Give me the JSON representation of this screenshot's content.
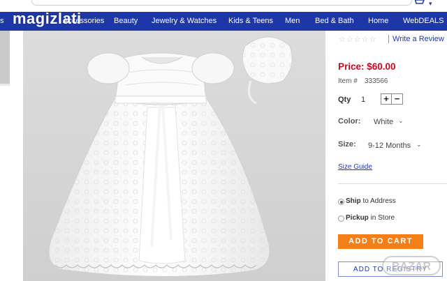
{
  "watermark": {
    "site_name": "magizlati",
    "badge_text": "BAZAR"
  },
  "nav": {
    "items": [
      {
        "label": "s"
      },
      {
        "label": "Accessories"
      },
      {
        "label": "Beauty"
      },
      {
        "label": "Jewelry & Watches"
      },
      {
        "label": "Kids & Teens"
      },
      {
        "label": "Men"
      },
      {
        "label": "Bed & Bath"
      },
      {
        "label": "Home"
      },
      {
        "label": "WebDEALS"
      }
    ],
    "color": "#1e37a8"
  },
  "product": {
    "rating_stars": "☆☆☆☆☆",
    "review_link": "Write a Review",
    "price_label": "Price:",
    "price": "$60.00",
    "price_display": "Price: $60.00",
    "item_label": "Item #",
    "item_number": "333566",
    "qty_label": "Qty",
    "qty_value": "1",
    "qty_plus": "+",
    "qty_minus": "−",
    "color_label": "Color:",
    "color_value": "White",
    "size_label": "Size:",
    "size_value": "9-12 Months",
    "size_guide": "Size Guide",
    "ship_bold": "Ship",
    "ship_rest": " to Address",
    "pickup_bold": "Pickup",
    "pickup_rest": " in Store",
    "add_to_cart": "ADD TO CART",
    "add_to_registry": "ADD TO REGISTRY",
    "price_color": "#d0021b",
    "cart_button_color": "#f57f17"
  },
  "icons": {
    "cart": "shopping-cart-icon",
    "caret": "chevron-down-icon"
  }
}
